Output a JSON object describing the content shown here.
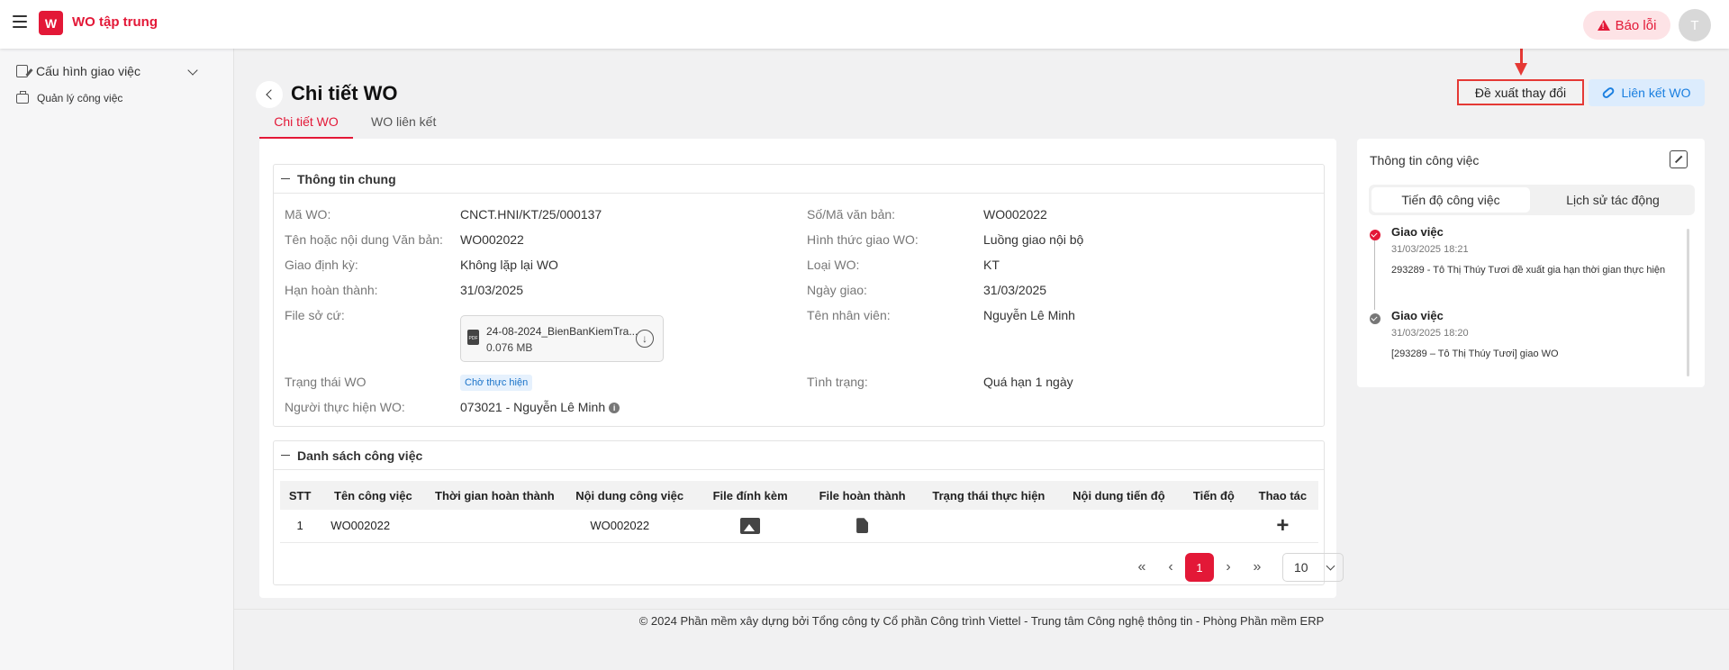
{
  "app": {
    "title": "WO tập trung",
    "logo_text": "W"
  },
  "topbar": {
    "report_label": "Báo lỗi",
    "avatar_letter": "T"
  },
  "sidebar": {
    "items": [
      {
        "label": "Cấu hình giao việc"
      },
      {
        "label": "Quản lý công việc"
      }
    ]
  },
  "header": {
    "title": "Chi tiết WO",
    "tabs": [
      {
        "label": "Chi tiết WO"
      },
      {
        "label": "WO liên kết"
      }
    ],
    "propose_label": "Đề xuất thay đổi",
    "link_label": "Liên kết WO"
  },
  "general": {
    "section_title": "Thông tin chung",
    "left": [
      {
        "label": "Mã WO:",
        "value": "CNCT.HNI/KT/25/000137"
      },
      {
        "label": "Tên hoặc nội dung Văn bản:",
        "value": "WO002022"
      },
      {
        "label": "Giao định kỳ:",
        "value": "Không lặp lại WO"
      },
      {
        "label": "Hạn hoàn thành:",
        "value": "31/03/2025"
      },
      {
        "label": "File sở cứ:"
      },
      {
        "label": "Trạng thái WO",
        "value": "Chờ thực hiện"
      },
      {
        "label": "Người thực hiện WO:",
        "value": "073021 - Nguyễn Lê Minh"
      }
    ],
    "right": [
      {
        "label": "Số/Mã văn bản:",
        "value": "WO002022"
      },
      {
        "label": "Hình thức giao WO:",
        "value": "Luồng giao nội bộ"
      },
      {
        "label": "Loại WO:",
        "value": "KT"
      },
      {
        "label": "Ngày giao:",
        "value": "31/03/2025"
      },
      {
        "label": "Tên nhân viên:",
        "value": "Nguyễn Lê Minh"
      },
      {
        "label": "Tình trạng:",
        "value": "Quá hạn 1 ngày"
      }
    ],
    "file": {
      "name": "24-08-2024_BienBanKiemTra...",
      "size": "0.076 MB",
      "type_label": "PDF"
    }
  },
  "tasks": {
    "section_title": "Danh sách công việc",
    "columns": [
      "STT",
      "Tên công việc",
      "Thời gian hoàn thành",
      "Nội dung công việc",
      "File đính kèm",
      "File hoàn thành",
      "Trạng thái thực hiện",
      "Nội dung tiến độ",
      "Tiến độ",
      "Thao tác"
    ],
    "rows": [
      {
        "stt": "1",
        "name": "WO002022",
        "time": "",
        "content": "WO002022"
      }
    ],
    "pagination": {
      "current": "1",
      "page_size": "10",
      "first": "«",
      "prev": "‹",
      "next": "›",
      "last": "»"
    }
  },
  "panel": {
    "title": "Thông tin công việc",
    "tabs": [
      "Tiến độ công việc",
      "Lịch sử tác động"
    ],
    "timeline": [
      {
        "title": "Giao việc",
        "time": "31/03/2025 18:21",
        "desc": "293289 - Tô Thị Thúy Tươi đề xuất gia hạn thời gian thực hiện",
        "color": "#e31837"
      },
      {
        "title": "Giao việc",
        "time": "31/03/2025 18:20",
        "desc": "[293289 – Tô Thị Thúy Tươi] giao WO",
        "color": "#777777"
      }
    ]
  },
  "footer": {
    "text": "© 2024 Phần mềm xây dựng bởi Tổng công ty Cổ phần Công trình Viettel - Trung tâm Công nghệ thông tin - Phòng Phần mềm ERP"
  },
  "colors": {
    "brand": "#e31837",
    "link": "#1a7fe0",
    "highlight": "#e53935"
  }
}
